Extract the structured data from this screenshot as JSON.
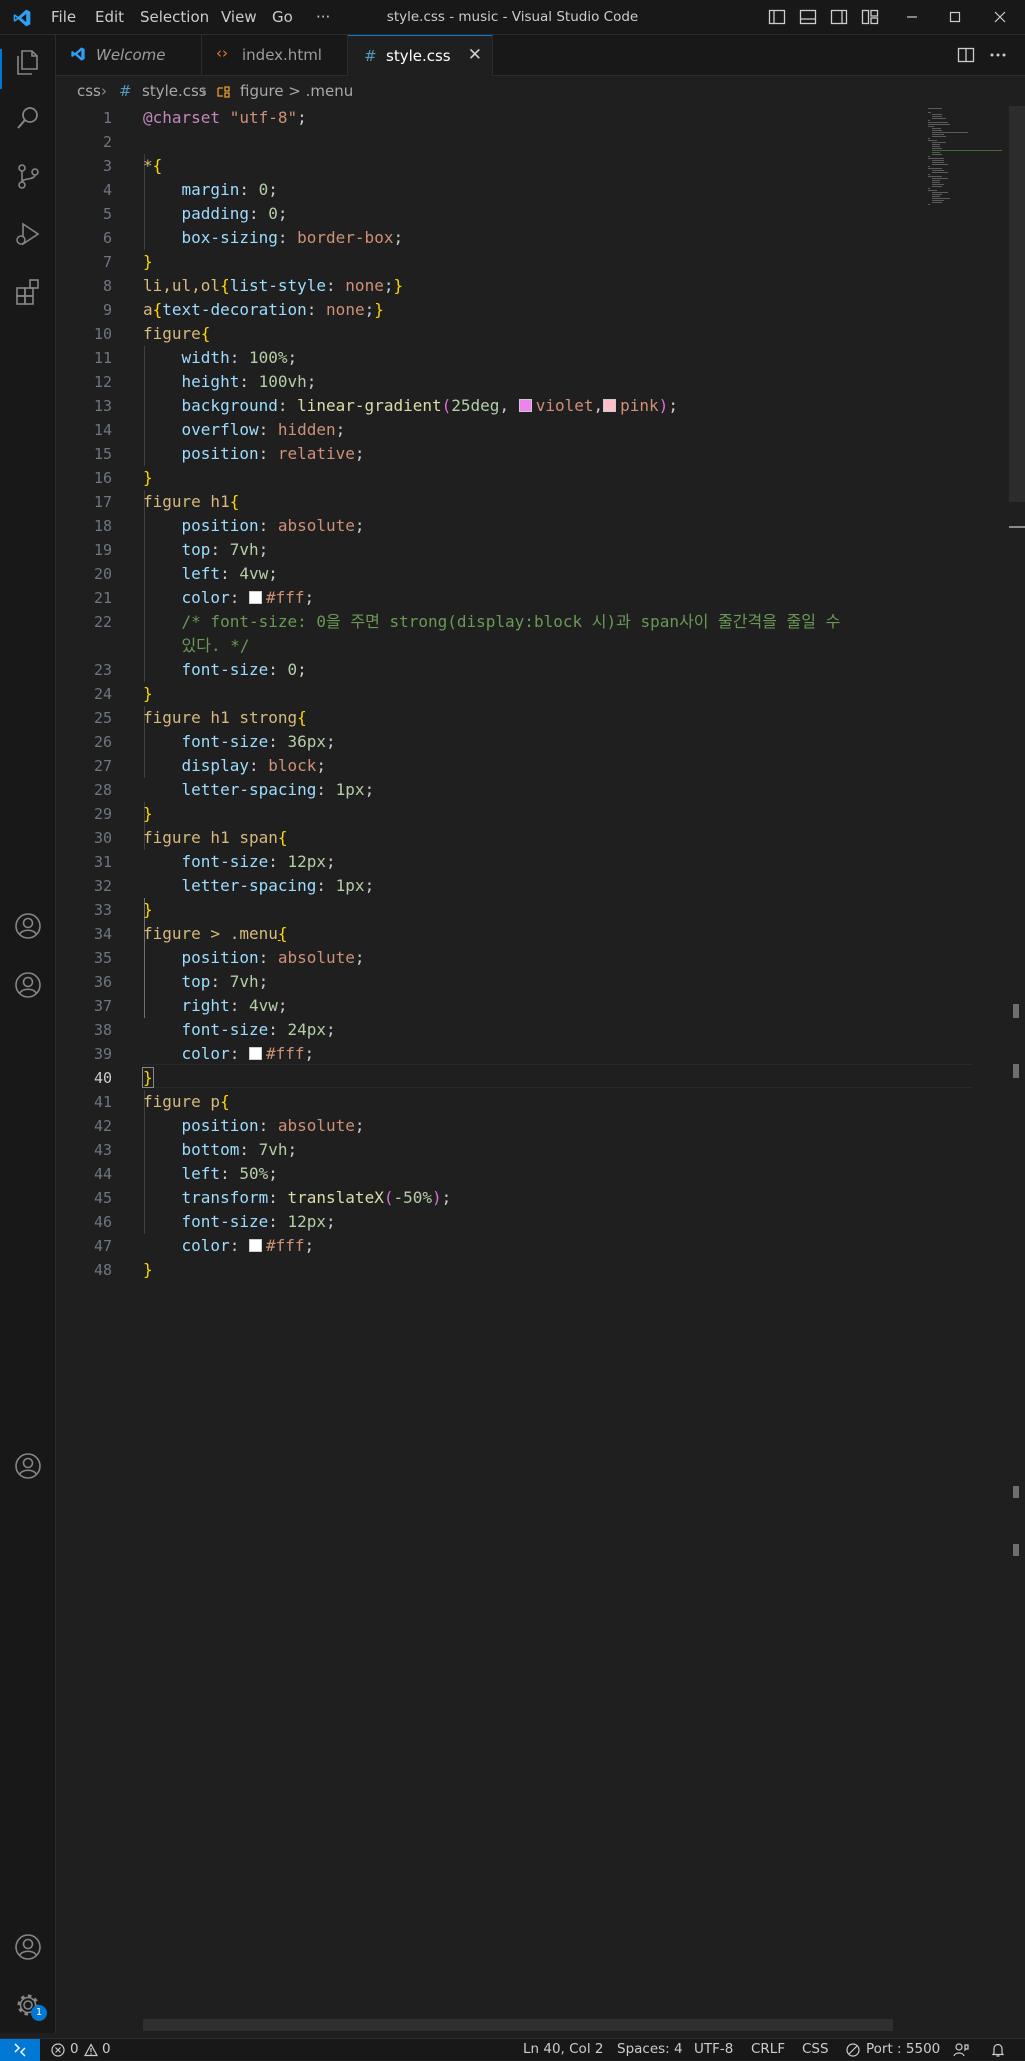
{
  "titlebar": {
    "menus": [
      "File",
      "Edit",
      "Selection",
      "View",
      "Go",
      "···"
    ],
    "title": "style.css - music - Visual Studio Code"
  },
  "tabs": [
    {
      "label": "Welcome",
      "icon": "vscode-icon"
    },
    {
      "label": "index.html",
      "icon": "html-icon"
    },
    {
      "label": "style.css",
      "icon": "css-hash-icon",
      "active": true
    }
  ],
  "breadcrumb": {
    "folder": "css",
    "file": "style.css",
    "symbol": "figure > .menu"
  },
  "editor": {
    "line_numbers": [
      "1",
      "2",
      "3",
      "4",
      "5",
      "6",
      "7",
      "8",
      "9",
      "10",
      "11",
      "12",
      "13",
      "14",
      "15",
      "16",
      "17",
      "18",
      "19",
      "20",
      "21",
      "22",
      "23",
      "24",
      "25",
      "26",
      "27",
      "28",
      "29",
      "30",
      "31",
      "32",
      "33",
      "34",
      "35",
      "36",
      "37",
      "38",
      "39",
      "40",
      "41",
      "42",
      "43",
      "44",
      "45",
      "46",
      "47",
      "48"
    ],
    "current_line": "40",
    "colors": {
      "violet": "#ee82ee",
      "pink": "#ffc0cb",
      "white": "#ffffff"
    },
    "code": {
      "l1a": "@charset",
      "l1b": " \"utf-8\"",
      "l1c": ";",
      "l3a": "*",
      "l3b": "{",
      "l4a": "margin",
      "l4b": ": ",
      "l4c": "0",
      "l4d": ";",
      "l5a": "padding",
      "l5b": ": ",
      "l5c": "0",
      "l5d": ";",
      "l6a": "box-sizing",
      "l6b": ": ",
      "l6c": "border-box",
      "l6d": ";",
      "l7a": "}",
      "l8a": "li,ul,ol",
      "l8b": "{",
      "l8c": "list-style",
      "l8d": ": ",
      "l8e": "none",
      "l8f": ";",
      "l8g": "}",
      "l9a": "a",
      "l9b": "{",
      "l9c": "text-decoration",
      "l9d": ": ",
      "l9e": "none",
      "l9f": ";",
      "l9g": "}",
      "l10a": "figure",
      "l10b": "{",
      "l11a": "width",
      "l11b": ": ",
      "l11c": "100%",
      "l11d": ";",
      "l12a": "height",
      "l12b": ": ",
      "l12c": "100vh",
      "l12d": ";",
      "l13a": "background",
      "l13b": ": ",
      "l13c": "linear-gradient",
      "l13d": "(",
      "l13e": "25deg",
      "l13f": ", ",
      "l13g": "violet",
      "l13h": ",",
      "l13i": "pink",
      "l13j": ")",
      "l13k": ";",
      "l14a": "overflow",
      "l14b": ": ",
      "l14c": "hidden",
      "l14d": ";",
      "l15a": "position",
      "l15b": ": ",
      "l15c": "relative",
      "l15d": ";",
      "l16a": "}",
      "l17a": "figure h1",
      "l17b": "{",
      "l18a": "position",
      "l18b": ": ",
      "l18c": "absolute",
      "l18d": ";",
      "l19a": "top",
      "l19b": ": ",
      "l19c": "7vh",
      "l19d": ";",
      "l20a": "left",
      "l20b": ": ",
      "l20c": "4vw",
      "l20d": ";",
      "l21a": "color",
      "l21b": ": ",
      "l21c": "#fff",
      "l21d": ";",
      "l22a": "/* font-size: 0을 주면 strong(display:block 시)과 span사이 줄간격을 줄일 수",
      "l22b": "있다. */",
      "l23a": "font-size",
      "l23b": ": ",
      "l23c": "0",
      "l23d": ";",
      "l24a": "}",
      "l25a": "figure h1 strong",
      "l25b": "{",
      "l26a": "font-size",
      "l26b": ": ",
      "l26c": "36px",
      "l26d": ";",
      "l27a": "display",
      "l27b": ": ",
      "l27c": "block",
      "l27d": ";",
      "l28a": "letter-spacing",
      "l28b": ": ",
      "l28c": "1px",
      "l28d": ";",
      "l29a": "}",
      "l30a": "figure h1 span",
      "l30b": "{",
      "l31a": "font-size",
      "l31b": ": ",
      "l31c": "12px",
      "l31d": ";",
      "l32a": "letter-spacing",
      "l32b": ": ",
      "l32c": "1px",
      "l32d": ";",
      "l33a": "}",
      "l34a": "figure > .menu",
      "l34b": "{",
      "l35a": "position",
      "l35b": ": ",
      "l35c": "absolute",
      "l35d": ";",
      "l36a": "top",
      "l36b": ": ",
      "l36c": "7vh",
      "l36d": ";",
      "l37a": "right",
      "l37b": ": ",
      "l37c": "4vw",
      "l37d": ";",
      "l38a": "font-size",
      "l38b": ": ",
      "l38c": "24px",
      "l38d": ";",
      "l39a": "color",
      "l39b": ": ",
      "l39c": "#fff",
      "l39d": ";",
      "l40a": "}",
      "l41a": "figure p",
      "l41b": "{",
      "l42a": "position",
      "l42b": ": ",
      "l42c": "absolute",
      "l42d": ";",
      "l43a": "bottom",
      "l43b": ": ",
      "l43c": "7vh",
      "l43d": ";",
      "l44a": "left",
      "l44b": ": ",
      "l44c": "50%",
      "l44d": ";",
      "l45a": "transform",
      "l45b": ": ",
      "l45c": "translateX",
      "l45d": "(",
      "l45e": "-50%",
      "l45f": ")",
      "l45g": ";",
      "l46a": "font-size",
      "l46b": ": ",
      "l46c": "12px",
      "l46d": ";",
      "l47a": "color",
      "l47b": ": ",
      "l47c": "#fff",
      "l47d": ";",
      "l48a": "}"
    }
  },
  "statusbar": {
    "errors": "0",
    "warnings": "0",
    "position": "Ln 40, Col 2",
    "spaces": "Spaces: 4",
    "encoding": "UTF-8",
    "eol": "CRLF",
    "language": "CSS",
    "port": "Port : 5500"
  },
  "activity": {
    "badge": "1"
  },
  "accent": "#0078d4"
}
